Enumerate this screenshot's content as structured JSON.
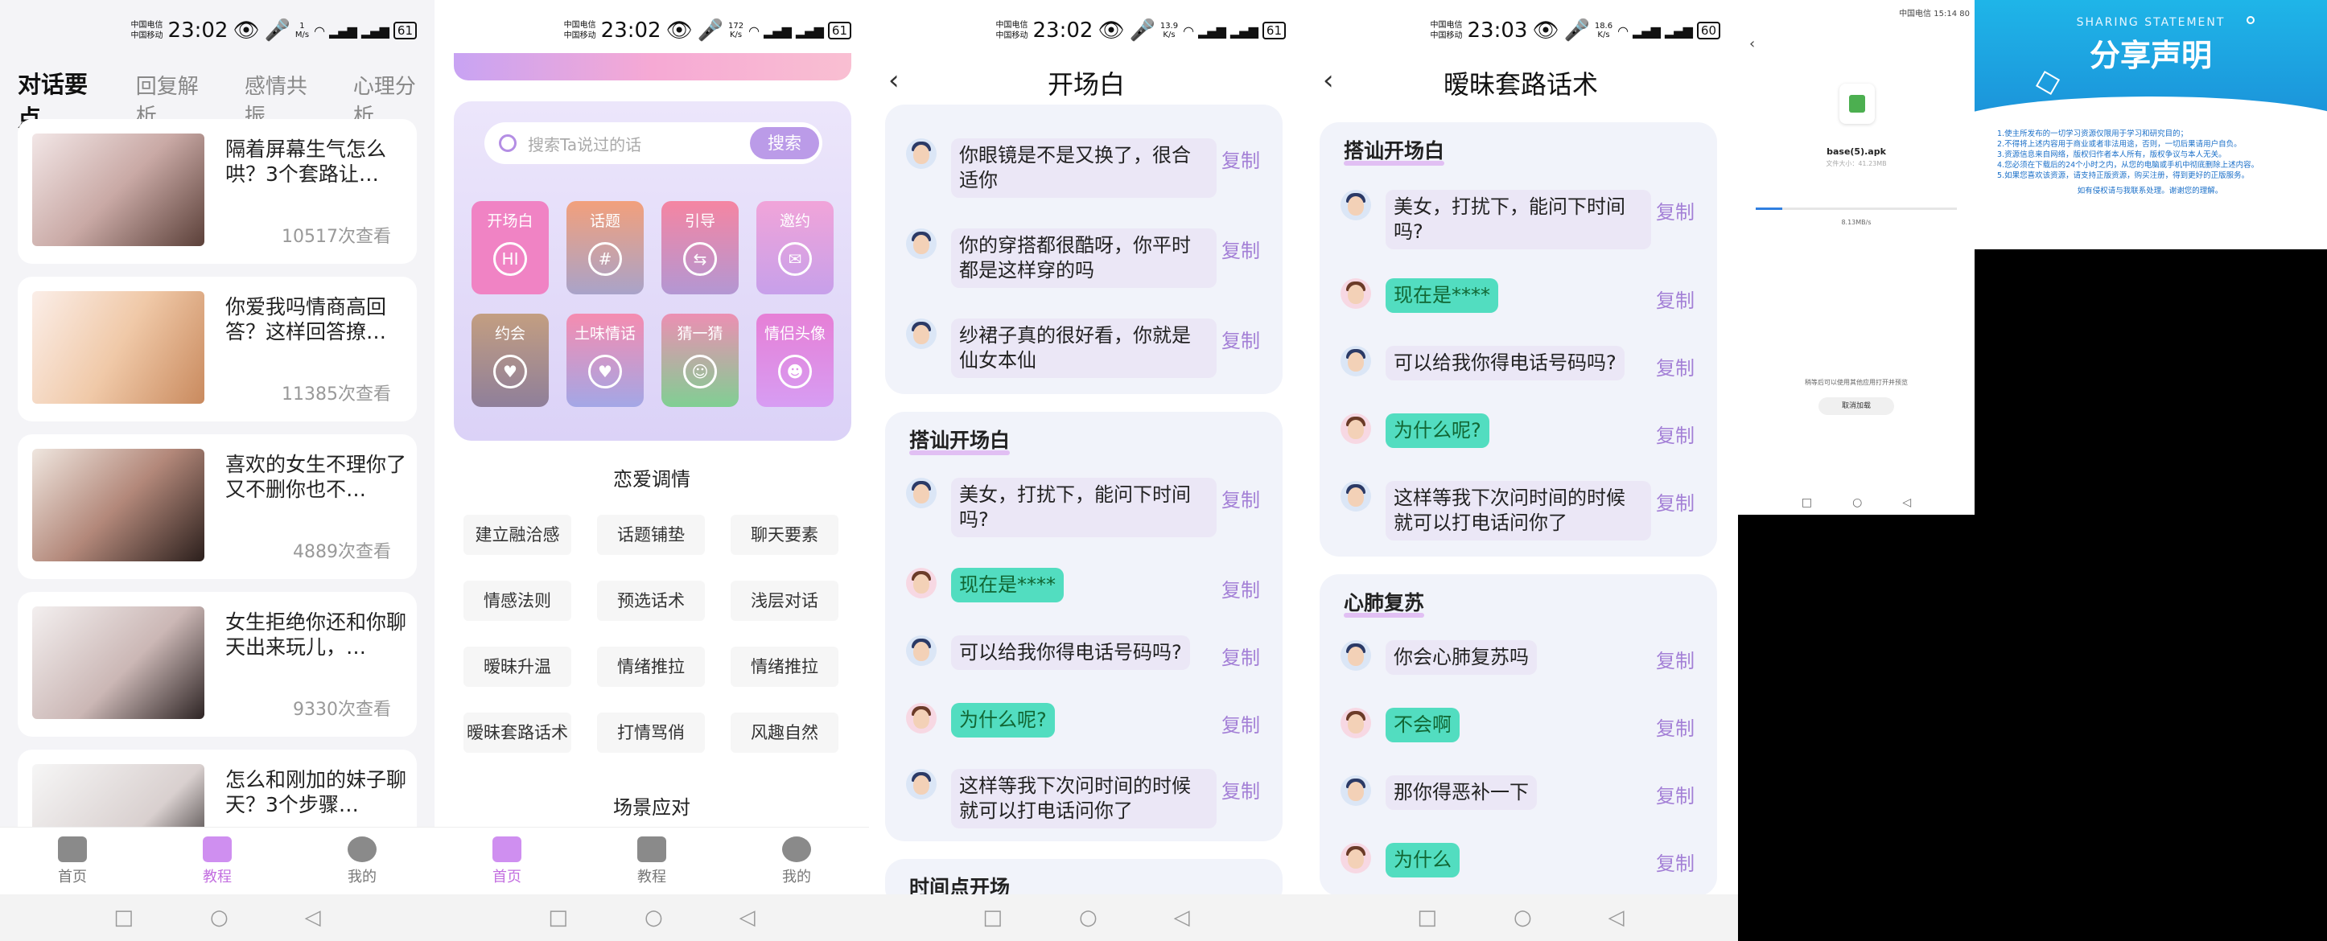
{
  "status": {
    "s1": {
      "c1": "中国电信",
      "c2": "中国移动",
      "time": "23:02",
      "speed_top": "1",
      "speed_bot": "M/s",
      "battery": "61"
    },
    "s2": {
      "c1": "中国电信",
      "c2": "中国移动",
      "time": "23:02",
      "speed_top": "172",
      "speed_bot": "K/s",
      "battery": "61"
    },
    "s3": {
      "c1": "中国电信",
      "c2": "中国移动",
      "time": "23:02",
      "speed_top": "13.9",
      "speed_bot": "K/s",
      "battery": "61"
    },
    "s4": {
      "c1": "中国电信",
      "c2": "中国移动",
      "time": "23:03",
      "speed_top": "18.6",
      "speed_bot": "K/s",
      "battery": "60"
    },
    "s5": {
      "c1": "中国电信",
      "c2": "中国移动",
      "time": "15:14",
      "battery": "80"
    }
  },
  "screen1": {
    "tabs": [
      "对话要点",
      "回复解析",
      "感情共振",
      "心理分析"
    ],
    "cards": [
      {
        "title": "隔着屏幕生气怎么哄？3个套路让…",
        "views": "10517次查看"
      },
      {
        "title": "你爱我吗情商高回答？这样回答撩…",
        "views": "11385次查看"
      },
      {
        "title": "喜欢的女生不理你了又不删你也不…",
        "views": "4889次查看"
      },
      {
        "title": "女生拒绝你还和你聊天出来玩儿，…",
        "views": "9330次查看"
      },
      {
        "title": "怎么和刚加的妹子聊天？3个步骤…",
        "views": ""
      }
    ]
  },
  "bottom_tabs": [
    "首页",
    "教程",
    "我的"
  ],
  "screen2": {
    "search_placeholder": "搜索Ta说过的话",
    "search_button": "搜索",
    "tiles": [
      {
        "label": "开场白",
        "icon": "HI",
        "color": "#f083c4"
      },
      {
        "label": "话题",
        "icon": "#",
        "color": "#e59a88"
      },
      {
        "label": "引导",
        "icon": "⇆",
        "color": "#f08aa3"
      },
      {
        "label": "邀约",
        "icon": "✉",
        "color": "#e3a4e5"
      },
      {
        "label": "约会",
        "icon": "♥",
        "color": "#9d8a96"
      },
      {
        "label": "土味情话",
        "icon": "♥",
        "color": "#ee8bb3"
      },
      {
        "label": "猜一猜",
        "icon": "☺",
        "color": "#86c79a"
      },
      {
        "label": "情侣头像",
        "icon": "☻",
        "color": "#e18ff0"
      }
    ],
    "section1": "恋爱调情",
    "chips": [
      "建立融洽感",
      "话题铺垫",
      "聊天要素",
      "情感法则",
      "预选话术",
      "浅层对话",
      "暧昧升温",
      "情绪推拉",
      "情绪推拉",
      "暧昧套路话术",
      "打情骂俏",
      "风趣自然"
    ],
    "section2": "场景应对"
  },
  "screen3": {
    "title": "开场白",
    "group0": [
      "你眼镜是不是又换了，很合适你",
      "你的穿搭都很酷呀，你平时都是这样穿的吗",
      "纱裙子真的很好看，你就是仙女本仙"
    ],
    "group1_title": "搭讪开场白",
    "group1": [
      "美女，打扰下，能问下时间吗?",
      "现在是****",
      "可以给我你得电话号码吗?",
      "为什么呢?",
      "这样等我下次问时间的时候就可以打电话问你了"
    ],
    "group2_title": "时间点开场",
    "copy": "复制"
  },
  "screen4": {
    "title": "暧昧套路话术",
    "group1_title": "搭讪开场白",
    "group1": [
      "美女，打扰下，能问下时间吗?",
      "现在是****",
      "可以给我你得电话号码吗?",
      "为什么呢?",
      "这样等我下次问时间的时候就可以打电话问你了"
    ],
    "group2_title": "心肺复苏",
    "group2": [
      "你会心肺复苏吗",
      "不会啊",
      "那你得恶补一下",
      "为什么"
    ],
    "copy": "复制"
  },
  "screen5": {
    "filename": "base(5).apk",
    "filesize": "文件大小：41.23MB",
    "speed": "8.13MB/s",
    "hint": "稍等后可以使用其他应用打开并预览",
    "cancel": "取消加载"
  },
  "screen6": {
    "label": "SHARING STATEMENT",
    "title": "分享声明",
    "lines": [
      "1.使主所发布的一切学习资源仅限用于学习和研究目的；",
      "2.不得将上述内容用于商业或者非法用途，否则，一切后果请用户自负。",
      "3.资源信息来自网络，版权归作者本人所有，版权争议与本人无关。",
      "4.您必须在下载后的24个小时之内，从您的电脑或手机中彻底删除上述内容。",
      "5.如果您喜欢该资源，请支持正版资源，购买注册，得到更好的正版服务。"
    ],
    "thanks": "如有侵权请与我联系处理。谢谢您的理解。"
  }
}
